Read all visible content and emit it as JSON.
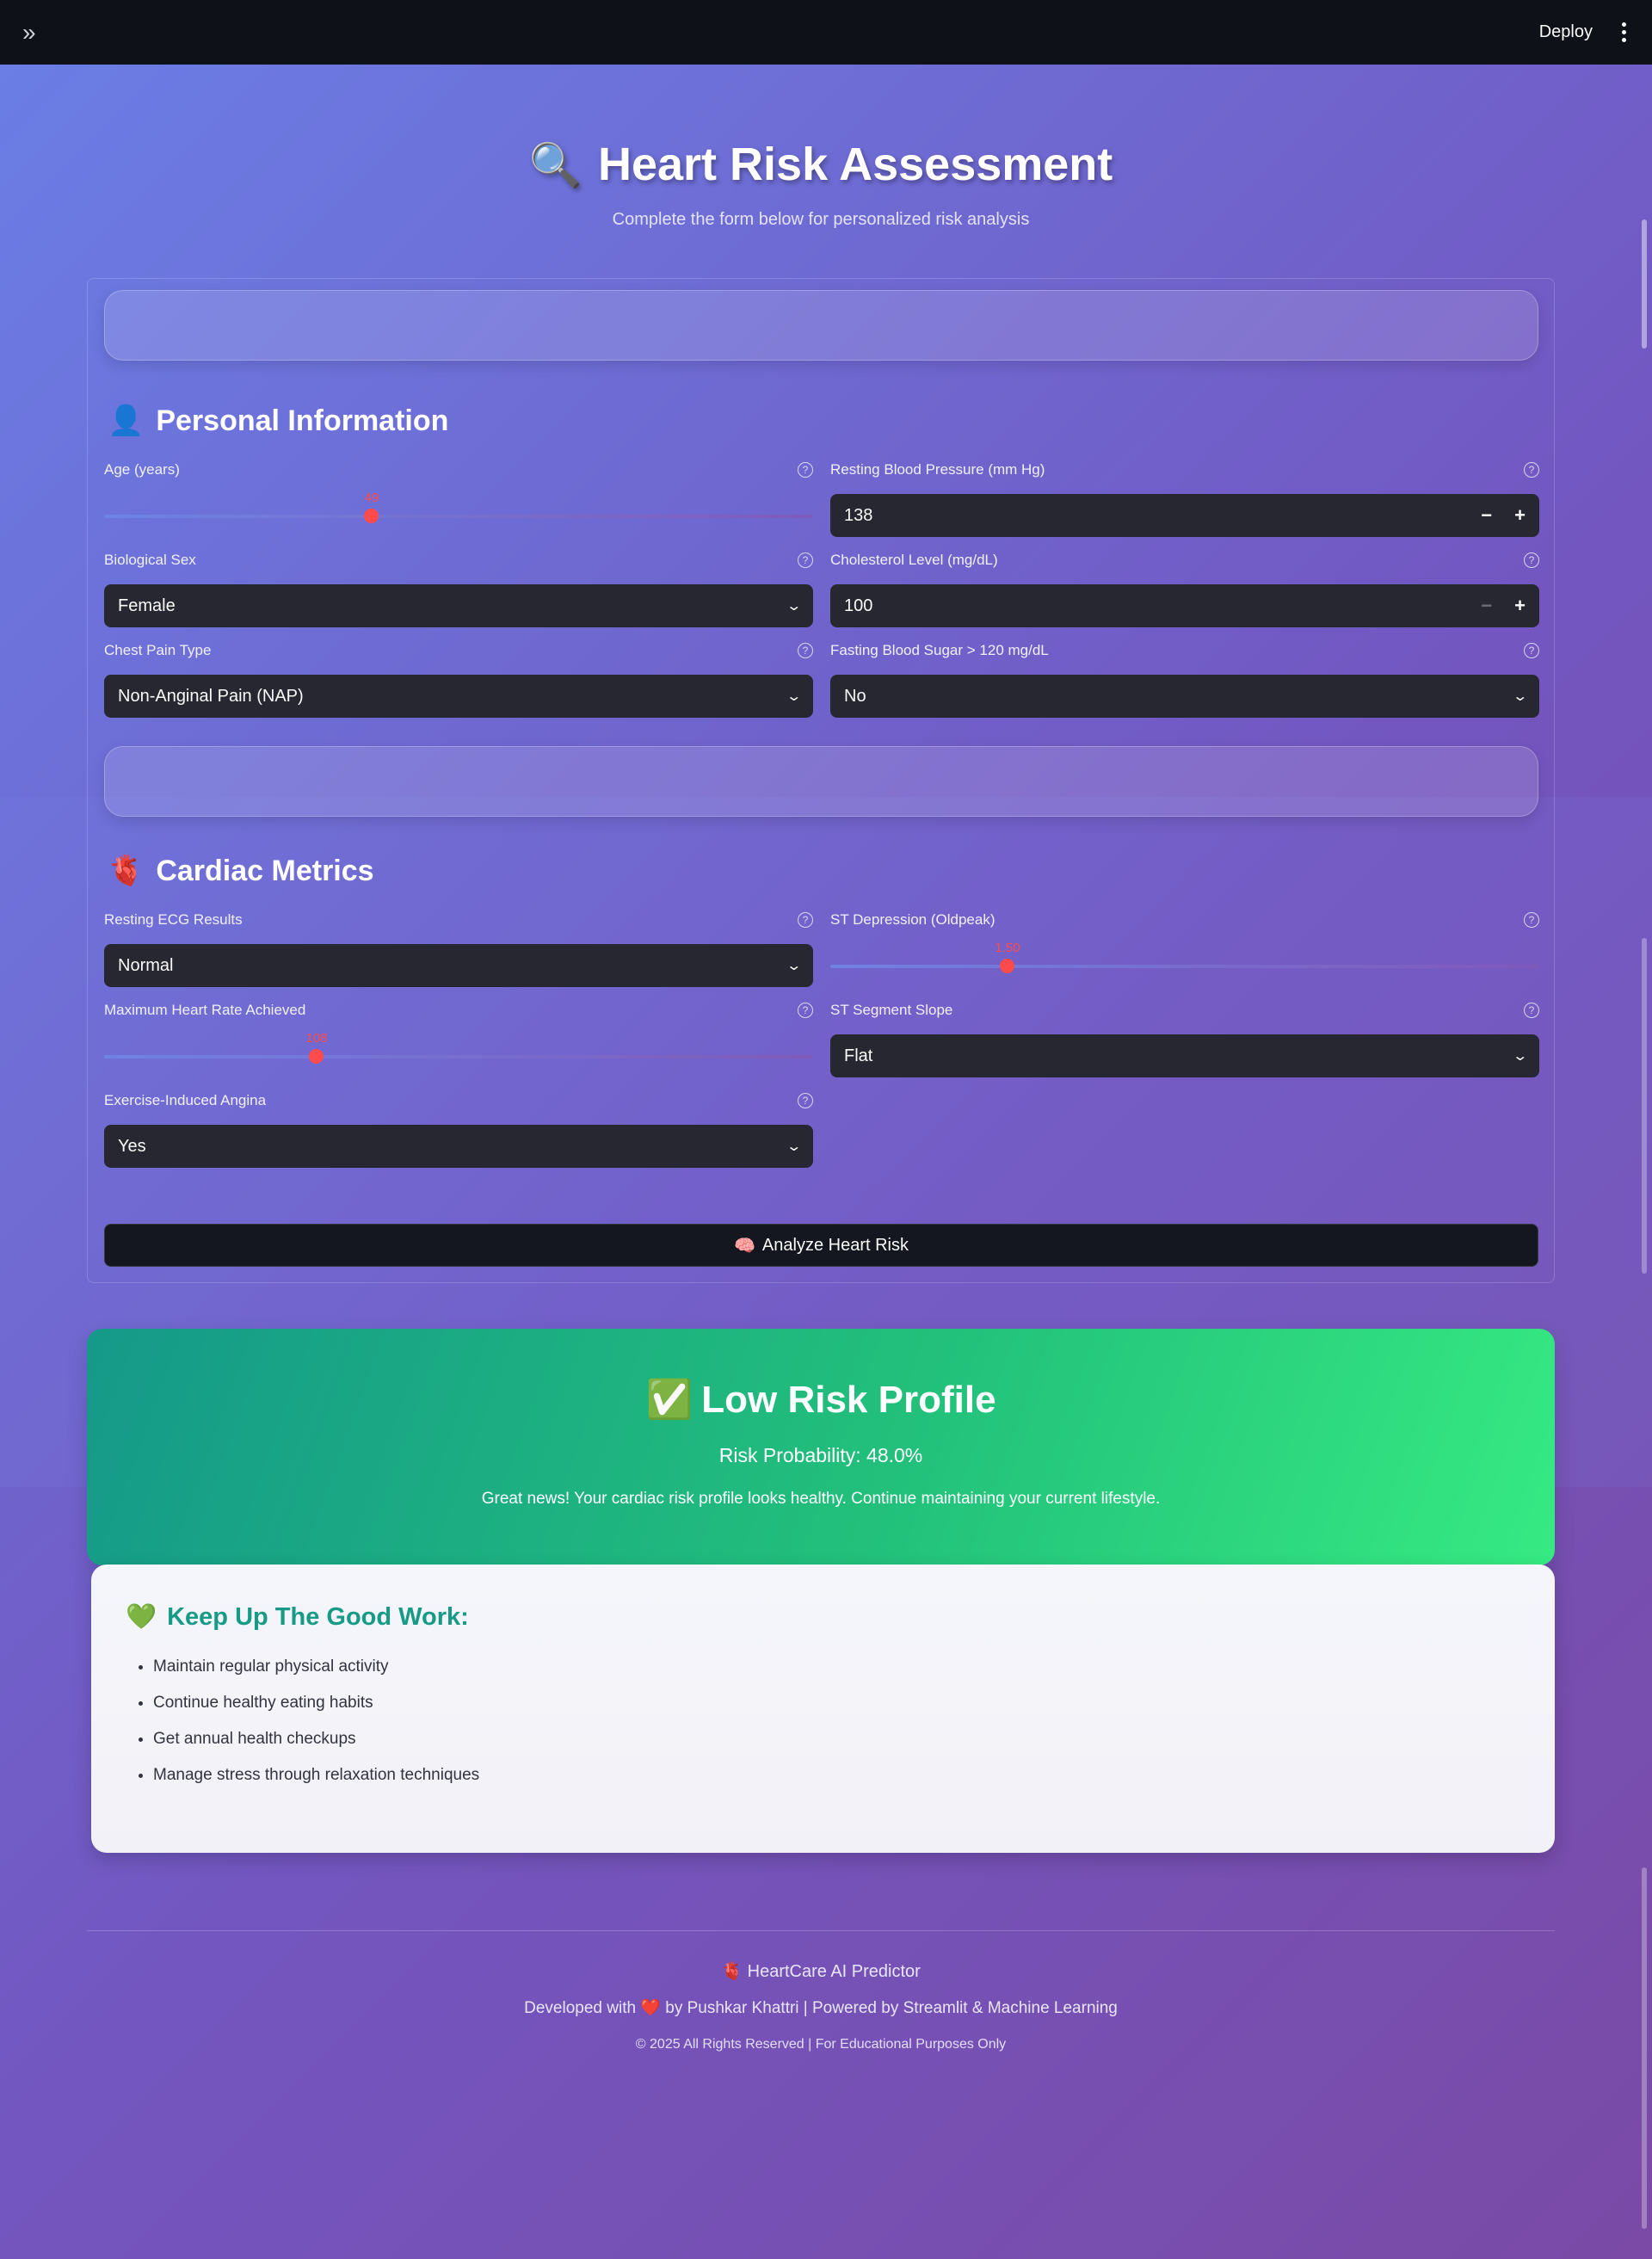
{
  "topbar": {
    "expand_icon": "»",
    "deploy_label": "Deploy"
  },
  "header": {
    "emoji": "🔍",
    "title": "Heart Risk Assessment",
    "subtitle": "Complete the form below for personalized risk analysis"
  },
  "personal": {
    "emoji": "👤",
    "title": "Personal Information",
    "age": {
      "label": "Age (years)",
      "value": "49",
      "fraction": 0.38
    },
    "bp": {
      "label": "Resting Blood Pressure (mm Hg)",
      "value": "138"
    },
    "sex": {
      "label": "Biological Sex",
      "value": "Female"
    },
    "chol": {
      "label": "Cholesterol Level (mg/dL)",
      "value": "100"
    },
    "chest_pain": {
      "label": "Chest Pain Type",
      "value": "Non-Anginal Pain (NAP)"
    },
    "fbs": {
      "label": "Fasting Blood Sugar > 120 mg/dL",
      "value": "No"
    }
  },
  "cardiac": {
    "emoji": "🫀",
    "title": "Cardiac Metrics",
    "ecg": {
      "label": "Resting ECG Results",
      "value": "Normal"
    },
    "oldpeak": {
      "label": "ST Depression (Oldpeak)",
      "value": "1.50",
      "fraction": 0.25
    },
    "max_hr": {
      "label": "Maximum Heart Rate Achieved",
      "value": "108",
      "fraction": 0.3
    },
    "slope": {
      "label": "ST Segment Slope",
      "value": "Flat"
    },
    "angina": {
      "label": "Exercise-Induced Angina",
      "value": "Yes"
    }
  },
  "analyze_button": {
    "emoji": "🧠",
    "label": "Analyze Heart Risk"
  },
  "result": {
    "emoji": "✅",
    "title": "Low Risk Profile",
    "probability": "Risk Probability: 48.0%",
    "message": "Great news! Your cardiac risk profile looks healthy. Continue maintaining your current lifestyle."
  },
  "tips": {
    "emoji": "💚",
    "title": "Keep Up The Good Work:",
    "items": [
      "Maintain regular physical activity",
      "Continue healthy eating habits",
      "Get annual health checkups",
      "Manage stress through relaxation techniques"
    ]
  },
  "footer": {
    "brand_emoji": "🫀",
    "brand": "HeartCare AI Predictor",
    "dev_prefix": "Developed with",
    "heart_emoji": "❤️",
    "dev_suffix": "by Pushkar Khattri | Powered by Streamlit & Machine Learning",
    "copyright": "© 2025 All Rights Reserved | For Educational Purposes Only"
  },
  "colors": {
    "accent": "#ff4b4b",
    "input_bg": "#262730",
    "success": "#22c07b",
    "tips_title": "#179a86"
  }
}
